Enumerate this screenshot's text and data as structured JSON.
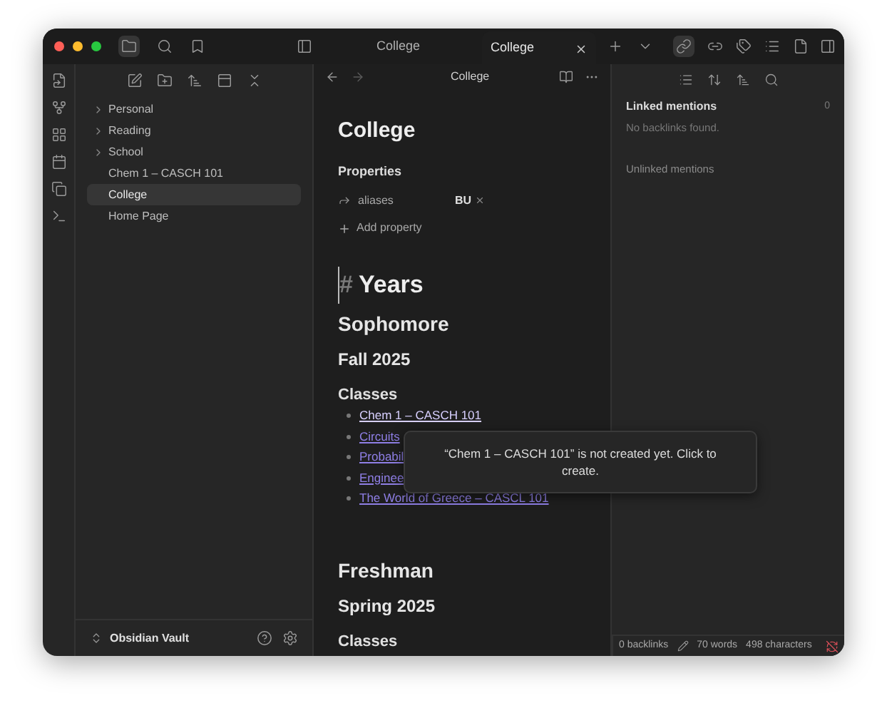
{
  "titlebar": {
    "tabs": [
      {
        "label": "College",
        "selected": false
      },
      {
        "label": "College",
        "selected": true
      }
    ]
  },
  "sidebar": {
    "items": [
      {
        "label": "Personal",
        "kind": "folder",
        "selected": false
      },
      {
        "label": "Reading",
        "kind": "folder",
        "selected": false
      },
      {
        "label": "School",
        "kind": "folder",
        "selected": false
      },
      {
        "label": "Chem 1 – CASCH 101",
        "kind": "file",
        "selected": false
      },
      {
        "label": "College",
        "kind": "file",
        "selected": true
      },
      {
        "label": "Home Page",
        "kind": "file",
        "selected": false
      }
    ],
    "vault": "Obsidian Vault"
  },
  "editor": {
    "header_title": "College",
    "title": "College",
    "properties_label": "Properties",
    "properties": [
      {
        "name": "aliases",
        "value": "BU"
      }
    ],
    "add_property": "Add property",
    "blocks": [
      {
        "kind": "h1",
        "marker": "#",
        "text": "Years"
      },
      {
        "kind": "h2",
        "text": "Sophomore"
      },
      {
        "kind": "h3",
        "text": "Fall 2025"
      },
      {
        "kind": "h4",
        "text": "Classes"
      },
      {
        "kind": "list",
        "items": [
          {
            "text": "Chem 1 – CASCH 101",
            "hovered": true
          },
          {
            "text": "Circuits",
            "hovered": false
          },
          {
            "text": "Probabil",
            "hovered": false
          },
          {
            "text": "Enginee",
            "hovered": false
          },
          {
            "text": "The World of Greece – CASCL 101",
            "hovered": false
          }
        ]
      },
      {
        "kind": "h2",
        "text": "Freshman"
      },
      {
        "kind": "h3",
        "text": "Spring 2025"
      },
      {
        "kind": "h4",
        "text": "Classes"
      }
    ]
  },
  "tooltip": "“Chem 1 – CASCH 101” is not created yet. Click to create.",
  "backlinks": {
    "linked_title": "Linked mentions",
    "linked_count": "0",
    "empty": "No backlinks found.",
    "unlinked_title": "Unlinked mentions"
  },
  "status_bar": {
    "backlinks": "0 backlinks",
    "words": "70 words",
    "characters": "498 characters"
  }
}
